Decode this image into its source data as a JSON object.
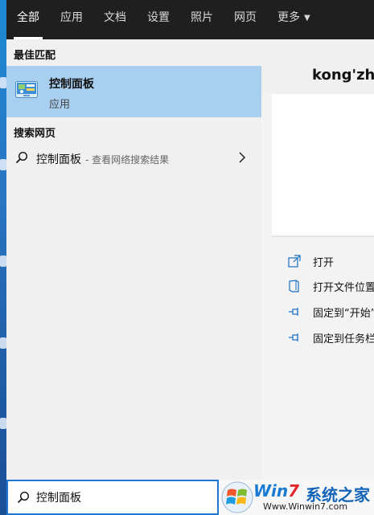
{
  "topbar": {
    "tabs": [
      {
        "label": "全部",
        "active": true
      },
      {
        "label": "应用",
        "active": false
      },
      {
        "label": "文档",
        "active": false
      },
      {
        "label": "设置",
        "active": false
      },
      {
        "label": "照片",
        "active": false
      },
      {
        "label": "网页",
        "active": false
      },
      {
        "label": "更多",
        "active": false,
        "has_dropdown": true
      }
    ],
    "dropdown_icon": "caret-down-icon"
  },
  "results": {
    "best_match_heading": "最佳匹配",
    "best_match": {
      "title": "控制面板",
      "subtitle": "应用",
      "icon": "control-panel-icon"
    },
    "web_heading": "搜索网页",
    "web_result": {
      "query": "控制面板",
      "hint": "- 查看网络搜索结果",
      "icon": "search-icon",
      "chevron": "chevron-right-icon"
    }
  },
  "preview": {
    "title": "kong'zhi",
    "actions": [
      {
        "label": "打开",
        "icon": "open-icon"
      },
      {
        "label": "打开文件位置",
        "icon": "file-location-icon"
      },
      {
        "label": "固定到“开始”屏幕",
        "icon": "pin-icon"
      },
      {
        "label": "固定到任务栏",
        "icon": "pin-icon"
      }
    ]
  },
  "search": {
    "value": "控制面板",
    "icon": "search-icon"
  },
  "watermark": {
    "brand_prefix": "Win",
    "brand_seven": "7",
    "brand_cn": "系统之家",
    "url": "Www.Winwin7.com"
  },
  "colors": {
    "topbar_bg": "#1f1f1f",
    "selected_bg": "#a8cff0",
    "search_border": "#1e78d2",
    "accent": "#1a7bd2"
  }
}
